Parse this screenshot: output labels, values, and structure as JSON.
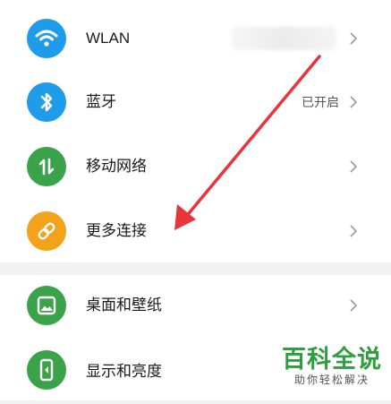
{
  "settings": {
    "rows": [
      {
        "label": "WLAN",
        "value": "",
        "icon": "wifi-icon",
        "color": "#1e9be9"
      },
      {
        "label": "蓝牙",
        "value": "已开启",
        "icon": "bluetooth-icon",
        "color": "#1e9be9"
      },
      {
        "label": "移动网络",
        "value": "",
        "icon": "mobile-network-icon",
        "color": "#3aa34a"
      },
      {
        "label": "更多连接",
        "value": "",
        "icon": "link-icon",
        "color": "#f2a21b"
      },
      {
        "label": "桌面和壁纸",
        "value": "",
        "icon": "wallpaper-icon",
        "color": "#3aa34a"
      },
      {
        "label": "显示和亮度",
        "value": "",
        "icon": "display-icon",
        "color": "#3aa34a"
      }
    ]
  },
  "annotation": {
    "arrow_color": "#e8343a"
  },
  "watermark": {
    "title": "百科全说",
    "subtitle": "助你轻松解决",
    "color": "#2e9e3e"
  }
}
